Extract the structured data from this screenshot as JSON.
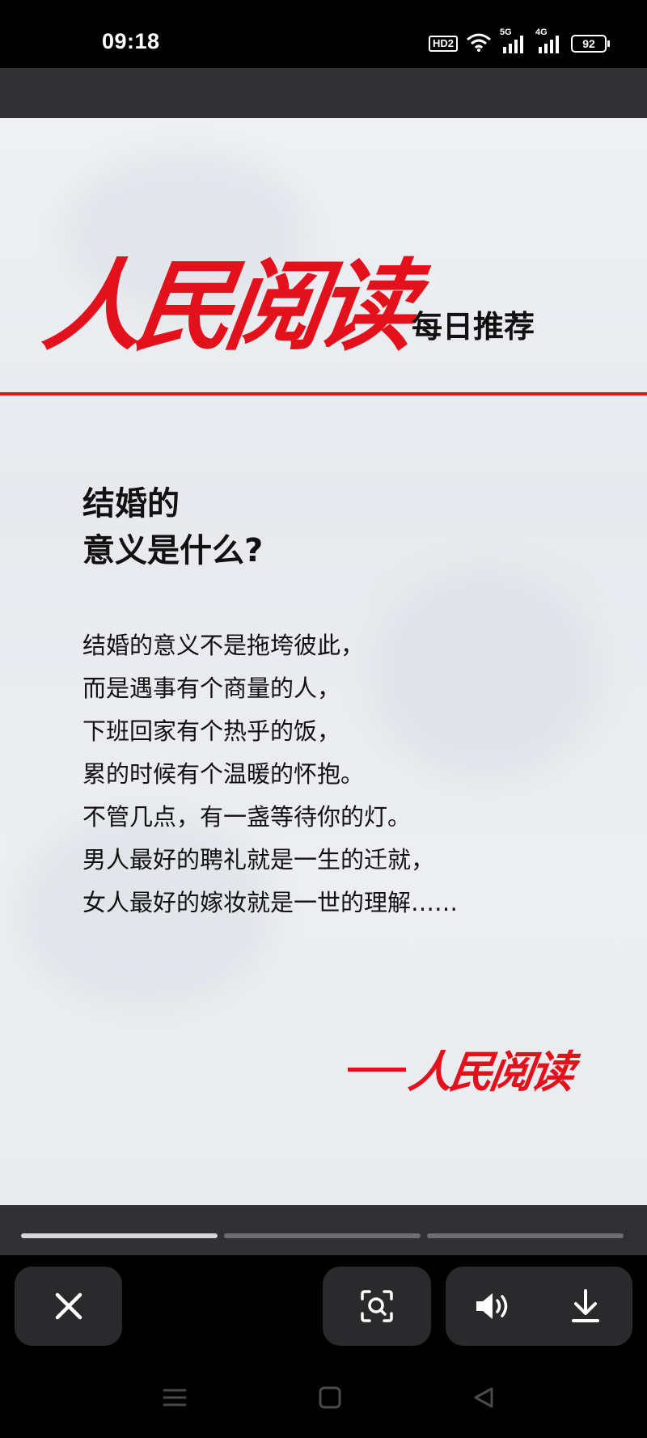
{
  "status_bar": {
    "time": "09:18",
    "hd_badge": "HD2",
    "sim1_label": "5G",
    "sim2_label": "4G",
    "battery": "92",
    "icons": [
      "hd-call-icon",
      "wifi-icon",
      "signal-5g-icon",
      "signal-4g-icon",
      "battery-icon"
    ]
  },
  "post": {
    "logo_text": "人民阅读",
    "logo_subtitle": "每日推荐",
    "headline_line1": "结婚的",
    "headline_line2": "意义是什么?",
    "poem": [
      "结婚的意义不是拖垮彼此，",
      "而是遇事有个商量的人，",
      "下班回家有个热乎的饭，",
      "累的时候有个温暖的怀抱。",
      "不管几点，有一盏等待你的灯。",
      "男人最好的聘礼就是一生的迁就，",
      "女人最好的嫁妆就是一世的理解……"
    ],
    "signature": "人民阅读",
    "accent_color": "#e3111b"
  },
  "story_progress": {
    "segments": 3,
    "active_index": 0
  },
  "actions": {
    "close": "close-icon",
    "scan": "image-search-icon",
    "sound": "speaker-icon",
    "download": "download-icon"
  },
  "navigation": [
    "menu-icon",
    "home-icon",
    "back-icon"
  ]
}
